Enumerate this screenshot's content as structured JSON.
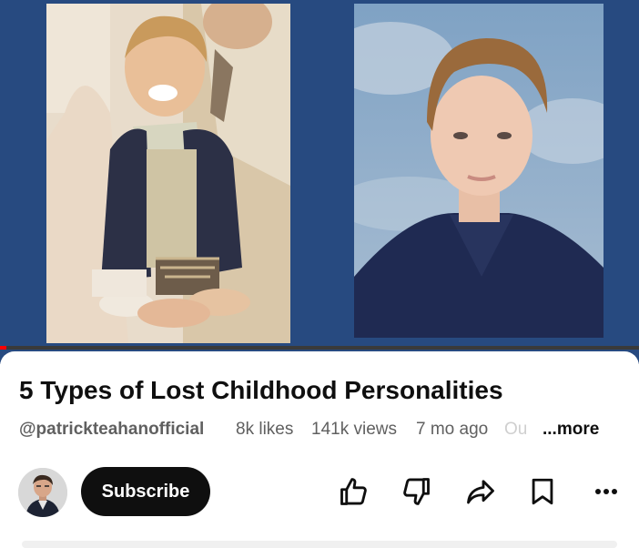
{
  "video": {
    "title": "5 Types of Lost Childhood Personalities",
    "progress_fraction": 0.01
  },
  "meta": {
    "channel_handle": "@patrickteahanofficial",
    "likes": "8k likes",
    "views": "141k views",
    "age": "7 mo ago",
    "truncated_fragment": "Ou",
    "more_label": "...more"
  },
  "channel": {
    "subscribe_label": "Subscribe"
  },
  "actions": [
    {
      "icon": "thumbs-up-icon",
      "name": "like"
    },
    {
      "icon": "thumbs-down-icon",
      "name": "dislike"
    },
    {
      "icon": "share-icon",
      "name": "share"
    },
    {
      "icon": "bookmark-icon",
      "name": "save"
    },
    {
      "icon": "more-horizontal-icon",
      "name": "more-actions"
    }
  ],
  "colors": {
    "thumbnail_background": "#274a80",
    "progress_red": "#ff0000",
    "text_primary": "#0f0f0f",
    "text_secondary": "#606060",
    "subscribe_bg": "#0f0f0f"
  }
}
